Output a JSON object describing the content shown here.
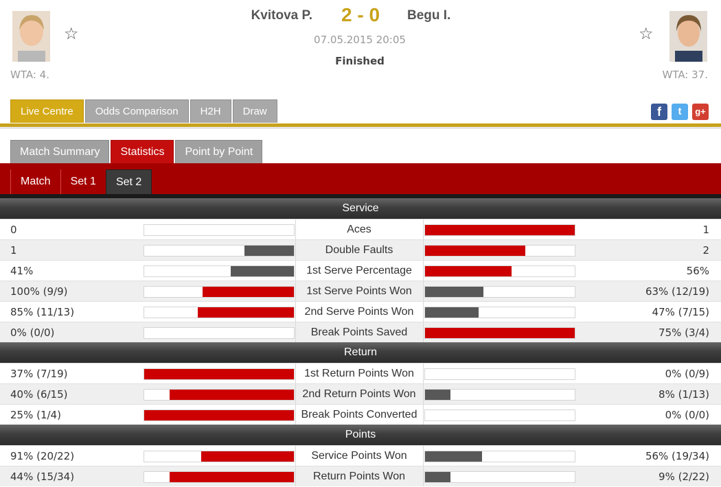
{
  "match": {
    "player_left": {
      "name": "Kvitova P.",
      "rank": "WTA: 4."
    },
    "player_right": {
      "name": "Begu I.",
      "rank": "WTA: 37."
    },
    "score": "2 - 0",
    "datetime": "07.05.2015 20:05",
    "status": "Finished"
  },
  "main_tabs": [
    "Live Centre",
    "Odds Comparison",
    "H2H",
    "Draw"
  ],
  "main_tab_active": "Live Centre",
  "social": {
    "facebook": "f",
    "twitter": "t",
    "googleplus": "g+"
  },
  "sub_tabs": [
    "Match Summary",
    "Statistics",
    "Point by Point"
  ],
  "sub_tab_active": "Statistics",
  "set_tabs": [
    "Match",
    "Set 1",
    "Set 2"
  ],
  "set_tab_active": "Set 2",
  "colors": {
    "accent_gold": "#c8a21b",
    "stat_red": "#cc0000",
    "stat_grey": "#585858",
    "bar_red": "#a50000"
  },
  "sections": [
    {
      "title": "Service",
      "rows": [
        {
          "label": "Aces",
          "left": "0",
          "right": "1",
          "left_pct": 0,
          "right_pct": 100,
          "left_color": "grey",
          "right_color": "red"
        },
        {
          "label": "Double Faults",
          "left": "1",
          "right": "2",
          "left_pct": 33,
          "right_pct": 67,
          "left_color": "grey",
          "right_color": "red"
        },
        {
          "label": "1st Serve Percentage",
          "left": "41%",
          "right": "56%",
          "left_pct": 42,
          "right_pct": 58,
          "left_color": "grey",
          "right_color": "red"
        },
        {
          "label": "1st Serve Points Won",
          "left": "100% (9/9)",
          "right": "63% (12/19)",
          "left_pct": 61,
          "right_pct": 39,
          "left_color": "red",
          "right_color": "grey"
        },
        {
          "label": "2nd Serve Points Won",
          "left": "85% (11/13)",
          "right": "47% (7/15)",
          "left_pct": 64,
          "right_pct": 36,
          "left_color": "red",
          "right_color": "grey"
        },
        {
          "label": "Break Points Saved",
          "left": "0% (0/0)",
          "right": "75% (3/4)",
          "left_pct": 0,
          "right_pct": 100,
          "left_color": "grey",
          "right_color": "red"
        }
      ]
    },
    {
      "title": "Return",
      "rows": [
        {
          "label": "1st Return Points Won",
          "left": "37% (7/19)",
          "right": "0% (0/9)",
          "left_pct": 100,
          "right_pct": 0,
          "left_color": "red",
          "right_color": "grey"
        },
        {
          "label": "2nd Return Points Won",
          "left": "40% (6/15)",
          "right": "8% (1/13)",
          "left_pct": 83,
          "right_pct": 17,
          "left_color": "red",
          "right_color": "grey"
        },
        {
          "label": "Break Points Converted",
          "left": "25% (1/4)",
          "right": "0% (0/0)",
          "left_pct": 100,
          "right_pct": 0,
          "left_color": "red",
          "right_color": "grey"
        }
      ]
    },
    {
      "title": "Points",
      "rows": [
        {
          "label": "Service Points Won",
          "left": "91% (20/22)",
          "right": "56% (19/34)",
          "left_pct": 62,
          "right_pct": 38,
          "left_color": "red",
          "right_color": "grey"
        },
        {
          "label": "Return Points Won",
          "left": "44% (15/34)",
          "right": "9% (2/22)",
          "left_pct": 83,
          "right_pct": 17,
          "left_color": "red",
          "right_color": "grey"
        }
      ]
    }
  ]
}
